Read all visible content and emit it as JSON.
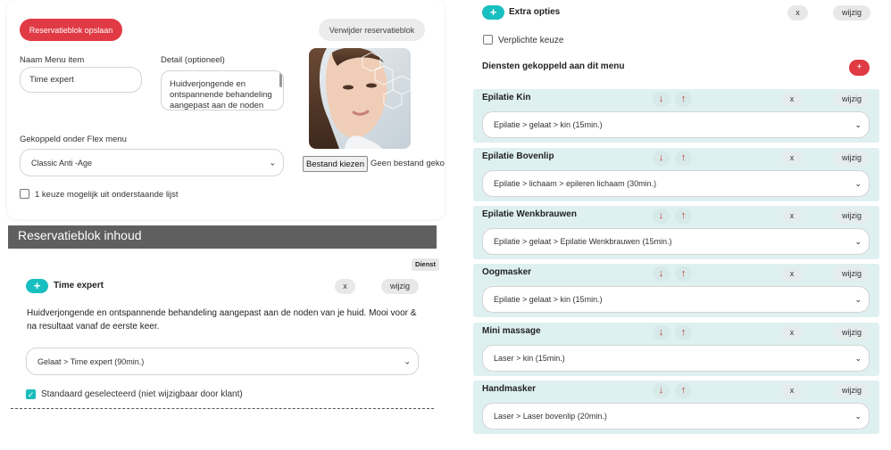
{
  "form": {
    "save_label": "Reservatieblok opslaan",
    "delete_label": "Verwijder reservatieblok",
    "name_label": "Naam Menu item",
    "name_value": "Time expert",
    "detail_label": "Detail (optioneel)",
    "detail_value": "Huidverjongende en ontspannende behandeling aangepast aan de noden van je huid.",
    "flex_label": "Gekoppeld onder Flex menu",
    "flex_value": "Classic Anti -Age",
    "file_button": "Bestand kiezen",
    "file_none": "Geen bestand gekozen",
    "single_choice_label": "1 keuze mogelijk uit onderstaande lijst"
  },
  "content": {
    "section_title": "Reservatieblok inhoud",
    "badge": "Dienst",
    "item_title": "Time expert",
    "x_label": "x",
    "wijzig_label": "wijzig",
    "description": "Huidverjongende en ontspannende behandeling aangepast aan de noden van je huid. Mooi voor & na resultaat vanaf de eerste keer.",
    "select_value": "Gelaat > Time expert (90min.)",
    "default_label": "Standaard geselecteerd (niet wijzigbaar door klant)"
  },
  "extra": {
    "title": "Extra opties",
    "x_label": "x",
    "wijzig_label": "wijzig",
    "mandatory_label": "Verplichte keuze",
    "services_heading": "Diensten gekoppeld aan dit menu",
    "add_symbol": "+"
  },
  "icons": {
    "plus": "+",
    "arrow_down": "↓",
    "arrow_up": "↑",
    "chevron": "⌄",
    "check": "✓"
  },
  "services": [
    {
      "title": "Epilatie Kin",
      "value": "Epilatie > gelaat > kin (15min.)"
    },
    {
      "title": "Epilatie Bovenlip",
      "value": "Epilatie > lichaam > epileren lichaam (30min.)"
    },
    {
      "title": "Epilatie Wenkbrauwen",
      "value": "Epilatie > gelaat > Epilatie Wenkbrauwen (15min.)"
    },
    {
      "title": "Oogmasker",
      "value": "Epilatie > gelaat > kin (15min.)"
    },
    {
      "title": "Mini massage",
      "value": "Laser > kin (15min.)"
    },
    {
      "title": "Handmasker",
      "value": "Laser > Laser bovenlip (20min.)"
    }
  ],
  "colors": {
    "accent_red": "#e03a45",
    "accent_teal": "#18bfc0",
    "service_bg": "#dff0f0",
    "section_bar": "#5f5f5f"
  }
}
